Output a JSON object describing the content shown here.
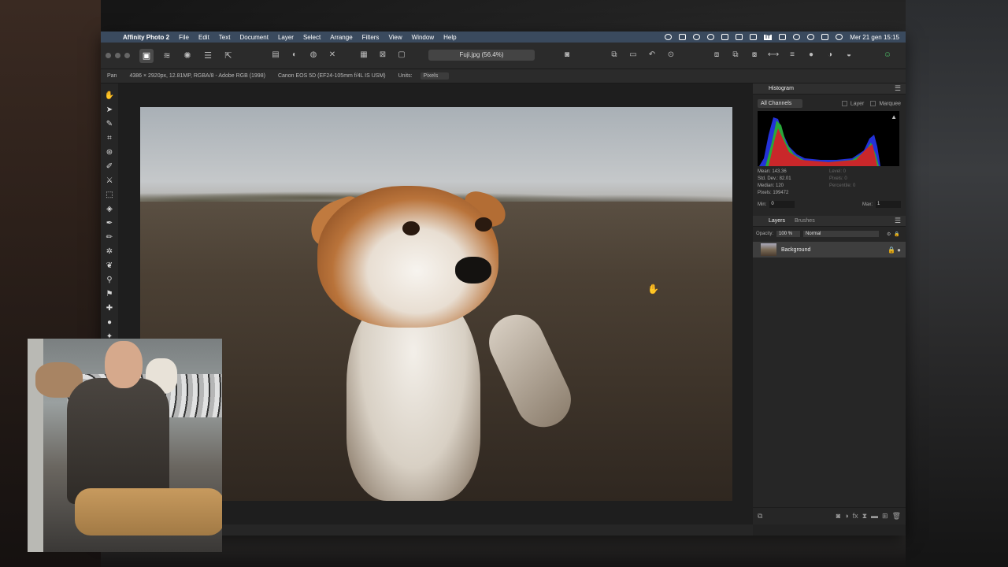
{
  "menubar": {
    "app_name": "Affinity Photo 2",
    "items": [
      "File",
      "Edit",
      "Text",
      "Document",
      "Layer",
      "Select",
      "Arrange",
      "Filters",
      "View",
      "Window",
      "Help"
    ],
    "clock": "Mer 21 gen  15:15",
    "input_badge": "IT"
  },
  "toolbar": {
    "document_title": "Fuji.jpg (56.4%)"
  },
  "context": {
    "tool_name": "Pan",
    "image_info": "4386 × 2920px, 12.81MP, RGBA/8 - Adobe RGB (1998)",
    "camera_info": "Canon EOS 5D (EF24-105mm f/4L IS USM)",
    "units_label": "Units:",
    "units_value": "Pixels"
  },
  "histogram": {
    "tab": "Histogram",
    "channel_select": "All Channels",
    "layer_label": "Layer",
    "marquee_label": "Marquee",
    "mean": "Mean: 143.36",
    "std_dev": "Std. Dev.: 82.01",
    "median": "Median: 120",
    "pixels": "Pixels: 199472",
    "level": "Level: 0",
    "pixels_right": "Pixels: 0",
    "percentile": "Percentile: 0",
    "min_label": "Min:",
    "min_value": "0",
    "max_label": "Max:",
    "max_value": "1"
  },
  "layers": {
    "tabs": [
      "Layers",
      "Brushes"
    ],
    "opacity_label": "Opacity:",
    "opacity_value": "100 %",
    "blend_mode": "Normal",
    "items": [
      {
        "name": "Background"
      }
    ]
  }
}
